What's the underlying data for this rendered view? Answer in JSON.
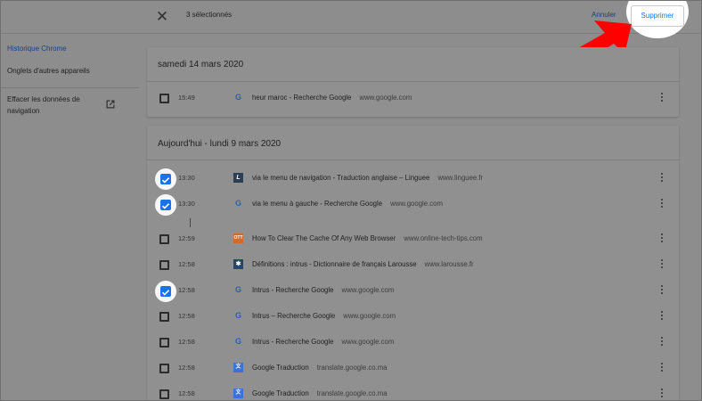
{
  "header": {
    "close_icon": "close-icon",
    "selection_count": "3 sélectionnés",
    "cancel_label": "Annuler",
    "delete_label": "Supprimer"
  },
  "sidebar": {
    "items": [
      {
        "label": "Historique Chrome",
        "active": true
      },
      {
        "label": "Onglets d'autres appareils",
        "active": false
      }
    ],
    "clear_data_line1": "Effacer les données de",
    "clear_data_line2": "navigation",
    "clear_data_icon": "open-in-new-icon"
  },
  "groups": [
    {
      "title": "samedi 14 mars 2020",
      "entries": [
        {
          "time": "15:49",
          "favicon": "google",
          "title": "heur maroc - Recherche Google",
          "domain": "www.google.com",
          "checked": false
        }
      ]
    },
    {
      "title": "Aujourd'hui - lundi 9 mars 2020",
      "entries": [
        {
          "time": "13:30",
          "favicon": "linguee",
          "favicon_text": "L",
          "title": "via le menu de navigation - Traduction anglaise – Linguee",
          "domain": "www.linguee.fr",
          "checked": true
        },
        {
          "time": "13:30",
          "favicon": "google",
          "favicon_text": "G",
          "title": "via le menu à gauche - Recherche Google",
          "domain": "www.google.com",
          "checked": true
        },
        {
          "time": "12:59",
          "favicon": "online-tech-tips",
          "favicon_text": "OTT",
          "title": "How To Clear The Cache Of Any Web Browser",
          "domain": "www.online-tech-tips.com",
          "checked": false
        },
        {
          "time": "12:58",
          "favicon": "larousse",
          "favicon_text": "✱",
          "title": "Définitions : intrus - Dictionnaire de français Larousse",
          "domain": "www.larousse.fr",
          "checked": false
        },
        {
          "time": "12:58",
          "favicon": "google",
          "favicon_text": "G",
          "title": "Intrus - Recherche Google",
          "domain": "www.google.com",
          "checked": true
        },
        {
          "time": "12:58",
          "favicon": "google",
          "favicon_text": "G",
          "title": "Intrus – Recherche Google",
          "domain": "www.google.com",
          "checked": false
        },
        {
          "time": "12:58",
          "favicon": "google",
          "favicon_text": "G",
          "title": "Intrus - Recherche Google",
          "domain": "www.google.com",
          "checked": false
        },
        {
          "time": "12:58",
          "favicon": "google-translate",
          "favicon_text": "文",
          "title": "Google Traduction",
          "domain": "translate.google.co.ma",
          "checked": false
        },
        {
          "time": "12:58",
          "favicon": "google-translate",
          "favicon_text": "文",
          "title": "Google Traduction",
          "domain": "translate.google.co.ma",
          "checked": false
        }
      ]
    }
  ],
  "colors": {
    "accent": "#1a73e8",
    "annotation_arrow": "#ff0000"
  }
}
